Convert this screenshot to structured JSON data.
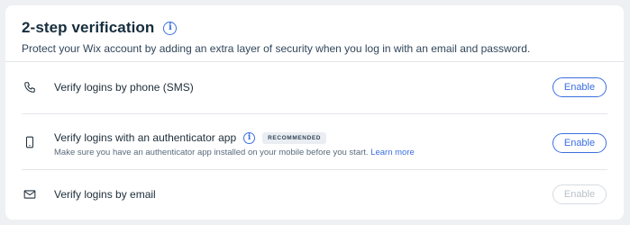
{
  "section": {
    "title": "2-step verification",
    "subtitle": "Protect your Wix account by adding an extra layer of security when you log in with an email and password."
  },
  "options": [
    {
      "icon": "phone-icon",
      "label": "Verify logins by phone (SMS)",
      "button": "Enable",
      "enabled": true
    },
    {
      "icon": "mobile-device-icon",
      "label": "Verify logins with an authenticator app",
      "badge": "RECOMMENDED",
      "description": "Make sure you have an authenticator app installed on your mobile before you start.",
      "link": "Learn more",
      "button": "Enable",
      "enabled": true
    },
    {
      "icon": "envelope-icon",
      "label": "Verify logins by email",
      "button": "Enable",
      "enabled": false
    }
  ],
  "colors": {
    "accent": "#3b6fe0",
    "text": "#162d3d",
    "background": "#eef0f3"
  }
}
